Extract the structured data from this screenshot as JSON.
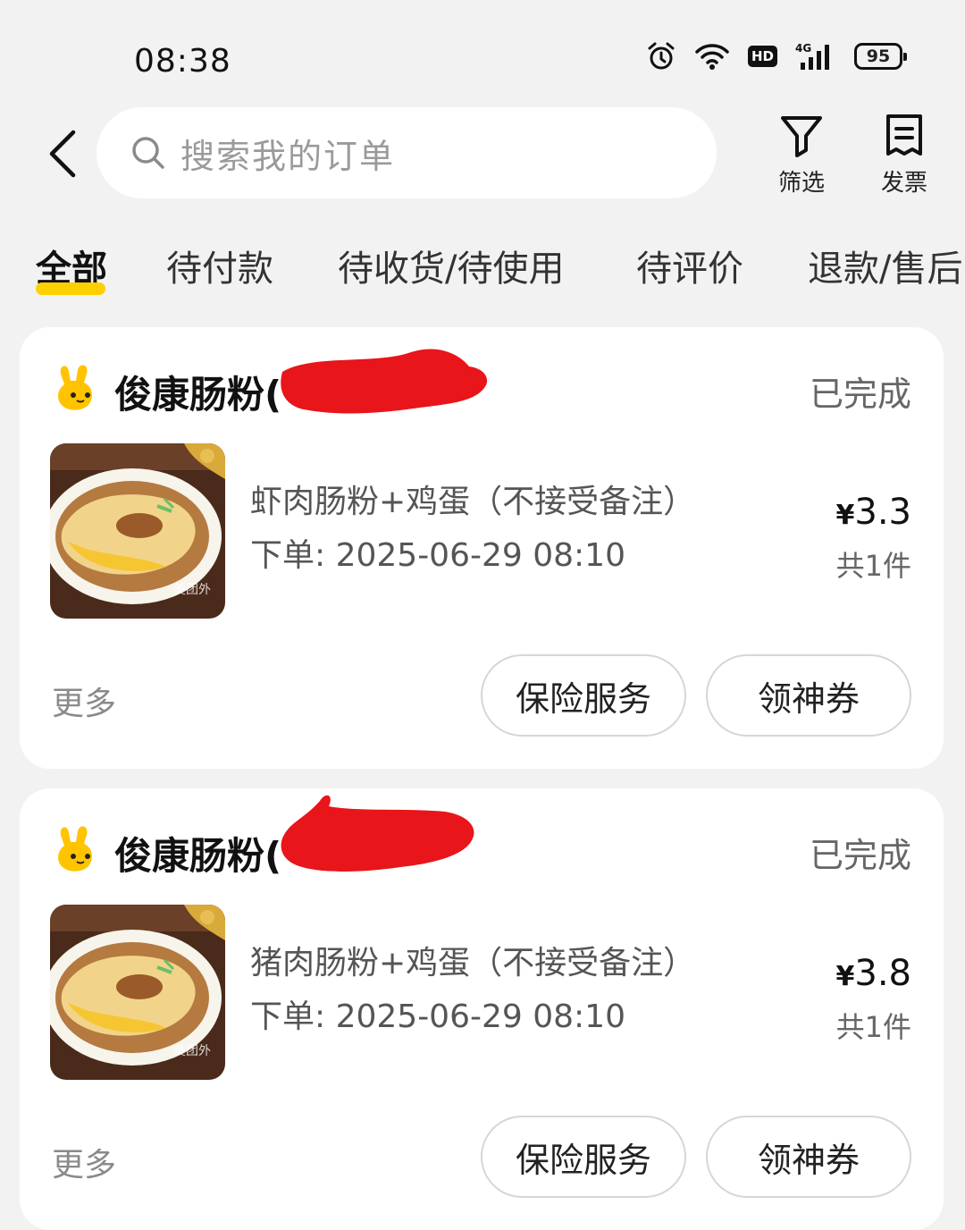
{
  "status_bar": {
    "time": "08:38",
    "battery": "95",
    "network": "4G",
    "hd": "HD"
  },
  "header": {
    "search_placeholder": "搜索我的订单",
    "filter_label": "筛选",
    "invoice_label": "发票"
  },
  "tabs": [
    {
      "label": "全部",
      "active": true
    },
    {
      "label": "待付款",
      "active": false
    },
    {
      "label": "待收货/待使用",
      "active": false
    },
    {
      "label": "待评价",
      "active": false
    },
    {
      "label": "退款/售后",
      "active": false
    }
  ],
  "orders": [
    {
      "shop_name": "俊康肠粉(",
      "status": "已完成",
      "item_name": "虾肉肠粉+鸡蛋（不接受备注）",
      "order_time": "下单: 2025-06-29 08:10",
      "price_symbol": "¥",
      "price": "3.3",
      "count": "共1件",
      "more": "更多",
      "btn_insurance": "保险服务",
      "btn_coupon": "领神券"
    },
    {
      "shop_name": "俊康肠粉(",
      "status": "已完成",
      "item_name": "猪肉肠粉+鸡蛋（不接受备注）",
      "order_time": "下单: 2025-06-29 08:10",
      "price_symbol": "¥",
      "price": "3.8",
      "count": "共1件",
      "more": "更多",
      "btn_insurance": "保险服务",
      "btn_coupon": "领神券"
    }
  ],
  "colors": {
    "accent": "#ffd000",
    "redaction": "#e8151b",
    "background": "#f2f2f2"
  }
}
